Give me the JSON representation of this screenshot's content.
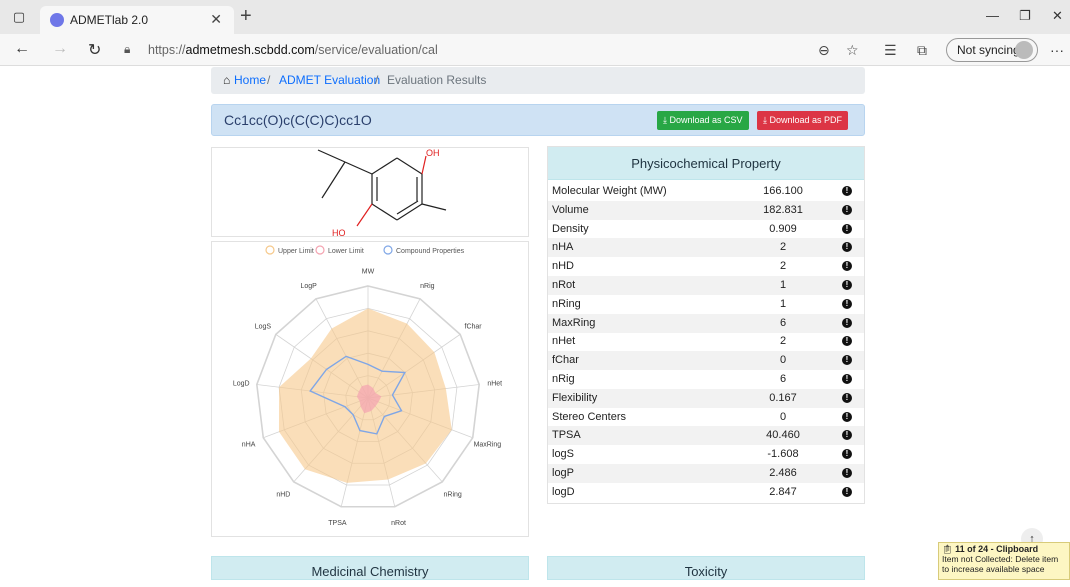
{
  "browser": {
    "tab_title": "ADMETlab 2.0",
    "url_prefix": "https://",
    "url_domain": "admetmesh.scbdd.com",
    "url_path": "/service/evaluation/cal",
    "sync_label": "Not syncing",
    "icons": [
      "tab-actions-icon",
      "close-icon",
      "new-tab-icon",
      "back-icon",
      "forward-icon",
      "refresh-icon",
      "lock-icon",
      "zoom-icon",
      "favorite-icon",
      "favorites-icon",
      "collections-icon",
      "more-icon"
    ]
  },
  "breadcrumb": {
    "home": "Home",
    "sep1": "/",
    "evaluation": "ADMET Evaluation",
    "sep2": "/",
    "current": "Evaluation Results"
  },
  "molecule": {
    "smiles": "Cc1cc(O)c(C(C)C)cc1O",
    "download_csv": "Download as CSV",
    "download_pdf": "Download as PDF",
    "atom_labels": {
      "oh_top": "OH",
      "ho_bottom": "HO"
    }
  },
  "radar": {
    "legend": [
      "Upper Limit",
      "Lower Limit",
      "Compound Properties"
    ],
    "axes": [
      "MW",
      "nRig",
      "fChar",
      "nHet",
      "MaxRing",
      "nRing",
      "nRot",
      "TPSA",
      "nHD",
      "nHA",
      "LogD",
      "LogS",
      "LogP"
    ],
    "upper": [
      0.8,
      0.75,
      0.72,
      0.7,
      0.8,
      0.78,
      0.75,
      0.78,
      0.85,
      0.85,
      0.8,
      0.62,
      0.7
    ],
    "lower": [
      0.12,
      0.1,
      0.08,
      0.12,
      0.1,
      0.1,
      0.12,
      0.14,
      0.1,
      0.08,
      0.1,
      0.1,
      0.12
    ],
    "compound": [
      0.3,
      0.27,
      0.4,
      0.22,
      0.32,
      0.22,
      0.33,
      0.3,
      0.2,
      0.22,
      0.52,
      0.45,
      0.42
    ],
    "colors": {
      "upper": "#f6c88a",
      "lower": "#f4a3b0",
      "compound": "#7fa6e6",
      "grid": "#d4d4d4"
    }
  },
  "phys": {
    "title": "Physicochemical Property",
    "rows": [
      {
        "name": "Molecular Weight (MW)",
        "value": "166.100"
      },
      {
        "name": "Volume",
        "value": "182.831"
      },
      {
        "name": "Density",
        "value": "0.909"
      },
      {
        "name": "nHA",
        "value": "2"
      },
      {
        "name": "nHD",
        "value": "2"
      },
      {
        "name": "nRot",
        "value": "1"
      },
      {
        "name": "nRing",
        "value": "1"
      },
      {
        "name": "MaxRing",
        "value": "6"
      },
      {
        "name": "nHet",
        "value": "2"
      },
      {
        "name": "fChar",
        "value": "0"
      },
      {
        "name": "nRig",
        "value": "6"
      },
      {
        "name": "Flexibility",
        "value": "0.167"
      },
      {
        "name": "Stereo Centers",
        "value": "0"
      },
      {
        "name": "TPSA",
        "value": "40.460"
      },
      {
        "name": "logS",
        "value": "-1.608"
      },
      {
        "name": "logP",
        "value": "2.486"
      },
      {
        "name": "logD",
        "value": "2.847"
      }
    ]
  },
  "sections": {
    "medicinal": "Medicinal Chemistry",
    "toxicity": "Toxicity"
  },
  "clipboard": {
    "title": "11 of 24 - Clipboard",
    "line1": "Item not Collected: Delete item",
    "line2": "to increase available space"
  }
}
